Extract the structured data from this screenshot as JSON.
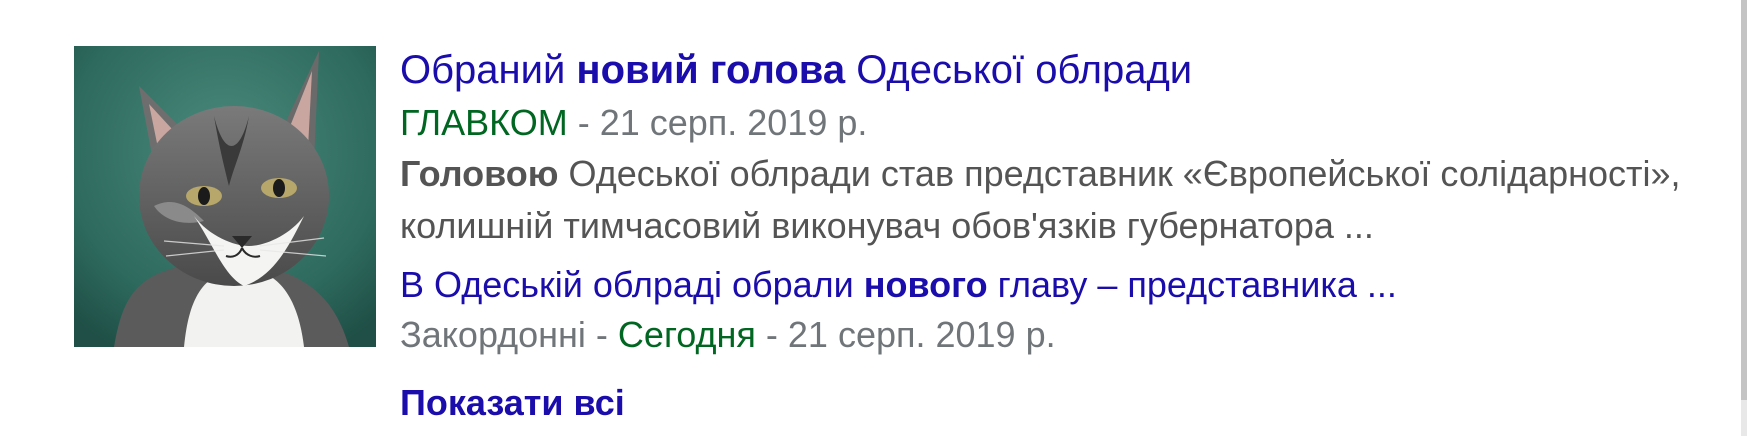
{
  "result": {
    "thumbnail_alt": "cat photo",
    "title": {
      "pre": "Обраний ",
      "bold": "новий голова",
      "post": " Одеської облради"
    },
    "meta": {
      "source": "ГЛАВКОМ",
      "separator": " - ",
      "date": "21 серп. 2019 р."
    },
    "snippet": {
      "bold": "Головою",
      "line1_rest": " Одеської облради став представник «Європейської солідарності»,",
      "line2": "колишній тимчасовий виконувач обов'язків губернатора ..."
    },
    "related": {
      "pre": "В Одеській облраді обрали ",
      "bold": "нового",
      "post": " главу – представника ...",
      "meta_prefix": "Закордонні - ",
      "source": "Сегодня",
      "separator": " - ",
      "date": "21 серп. 2019 р."
    },
    "show_all": "Показати всі"
  },
  "colors": {
    "link": "#1a0dab",
    "source_green": "#006621",
    "meta_gray": "#70757a",
    "snippet_gray": "#545454"
  }
}
